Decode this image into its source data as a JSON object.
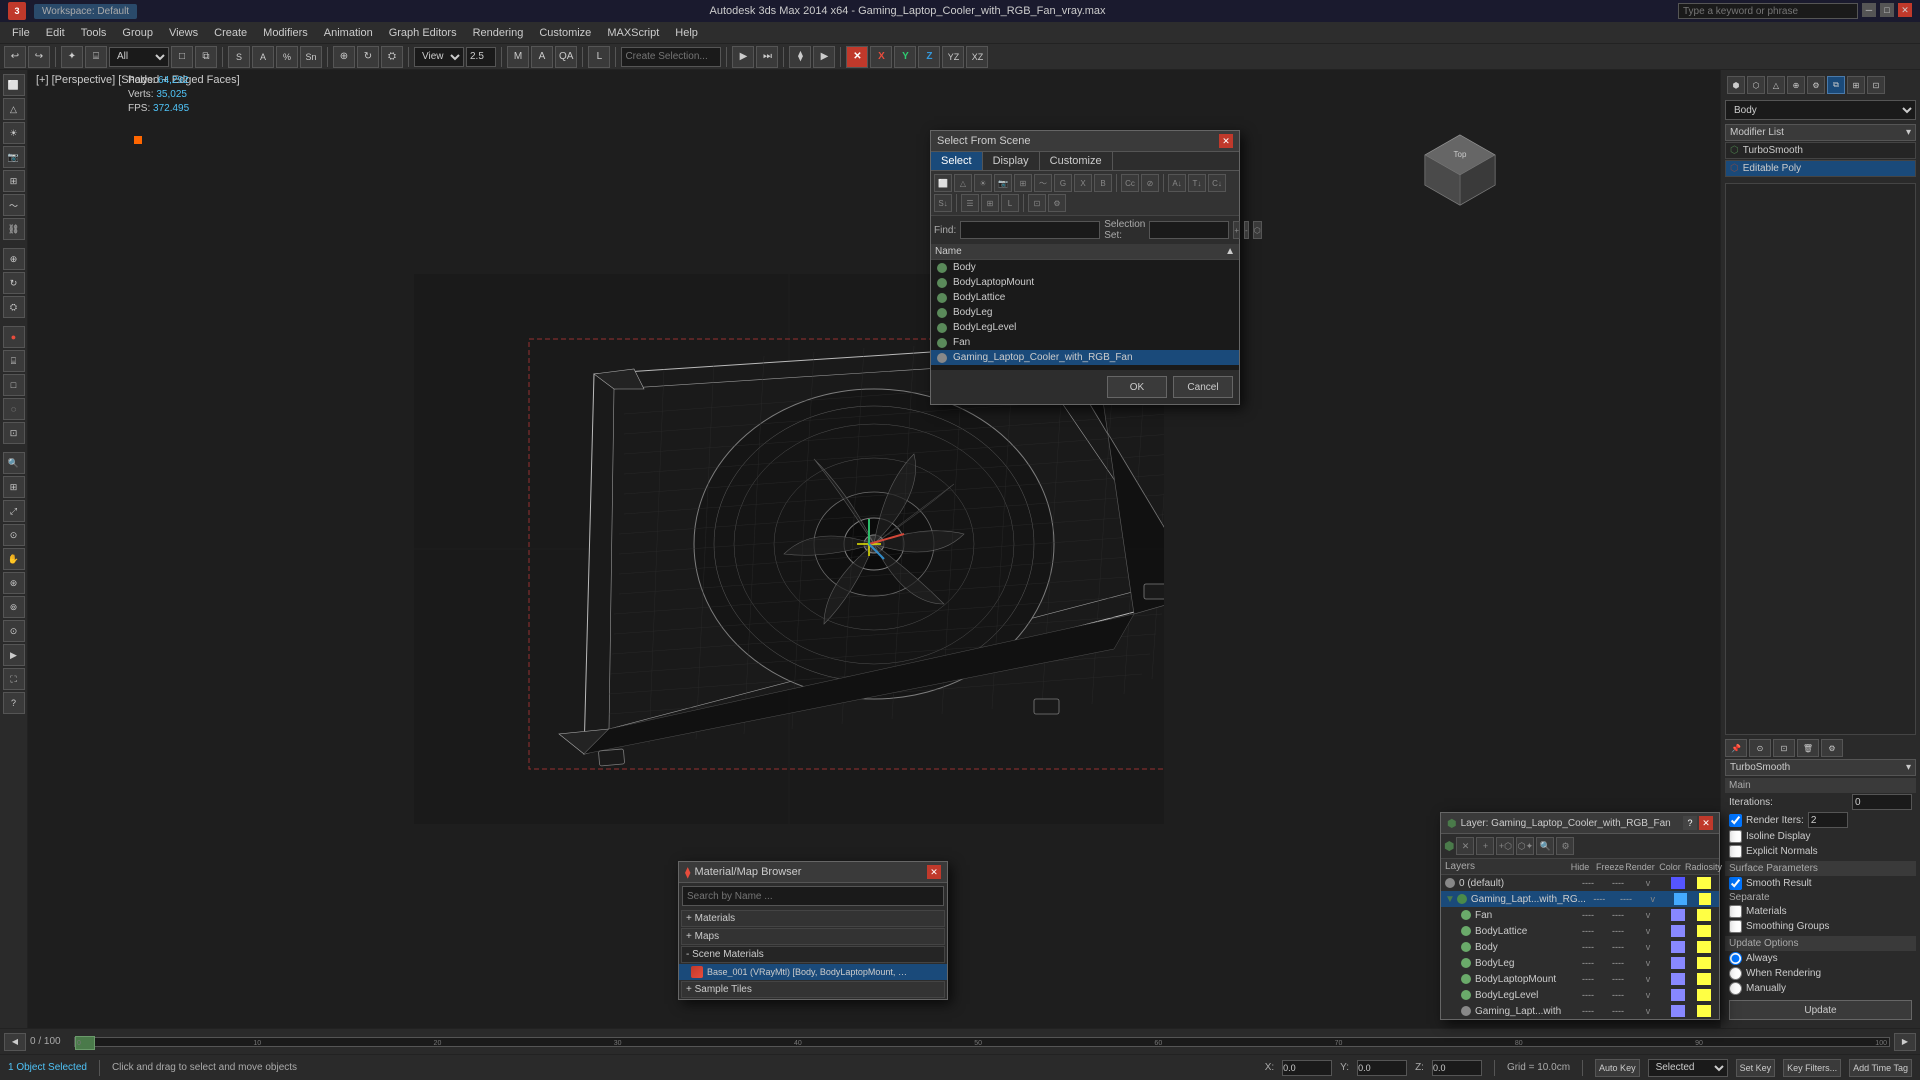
{
  "app": {
    "title": "Autodesk 3ds Max 2014 x64 - Gaming_Laptop_Cooler_with_RGB_Fan_vray.max",
    "workspace": "Workspace: Default"
  },
  "title_bar": {
    "workspace_label": "Workspace: Default",
    "title": "Autodesk 3ds Max 2014 x64 - Gaming_Laptop_Cooler_with_RGB_Fan_vray.max",
    "search_placeholder": "Type a keyword or phrase"
  },
  "menu_bar": {
    "items": [
      "File",
      "Edit",
      "Tools",
      "Group",
      "Views",
      "Create",
      "Modifiers",
      "Animation",
      "Graph Editors",
      "Rendering",
      "Customize",
      "MAXScript",
      "Help"
    ]
  },
  "viewport": {
    "label": "[+] [Perspective] [Shaded + Edged Faces]",
    "stats": {
      "polys_label": "Polys:",
      "polys_value": "64,292",
      "verts_label": "Verts:",
      "verts_value": "35,025",
      "fps_label": "FPS:",
      "fps_value": "372.495"
    }
  },
  "select_from_scene": {
    "title": "Select From Scene",
    "tabs": [
      "Select",
      "Display",
      "Customize"
    ],
    "active_tab": "Select",
    "find_label": "Find:",
    "find_placeholder": "",
    "selset_label": "Selection Set:",
    "name_header": "Name",
    "items": [
      {
        "name": "Body",
        "selected": false
      },
      {
        "name": "BodyLaptopMount",
        "selected": false
      },
      {
        "name": "BodyLattice",
        "selected": false
      },
      {
        "name": "BodyLeg",
        "selected": false
      },
      {
        "name": "BodyLegLevel",
        "selected": false
      },
      {
        "name": "Fan",
        "selected": false
      },
      {
        "name": "Gaming_Laptop_Cooler_with_RGB_Fan",
        "selected": true
      }
    ],
    "ok_button": "OK",
    "cancel_button": "Cancel"
  },
  "material_browser": {
    "title": "Material/Map Browser",
    "close_label": "×",
    "search_placeholder": "Search by Name ...",
    "groups": [
      {
        "label": "+ Materials",
        "open": false
      },
      {
        "label": "+ Maps",
        "open": false
      },
      {
        "label": "- Scene Materials",
        "open": true
      }
    ],
    "scene_materials": [
      {
        "name": "Base_001 (VRayMtl) [Body, BodyLaptopMount, BodyLattice, B..."
      }
    ],
    "sample_tiles_label": "+ Sample Tiles"
  },
  "layer_dialog": {
    "title": "Layer: Gaming_Laptop_Cooler_with_RGB_Fan",
    "close_label": "×",
    "columns": [
      "Layers",
      "Hide",
      "Freeze",
      "Render",
      "Color",
      "Radiosity"
    ],
    "layers": [
      {
        "name": "0 (default)",
        "indent": 0
      },
      {
        "name": "Gaming_Lapt...with_RG...",
        "indent": 0
      },
      {
        "name": "Fan",
        "indent": 1
      },
      {
        "name": "BodyLattice",
        "indent": 1
      },
      {
        "name": "Body",
        "indent": 1
      },
      {
        "name": "BodyLeg",
        "indent": 1
      },
      {
        "name": "BodyLaptopMount",
        "indent": 1
      },
      {
        "name": "BodyLegLevel",
        "indent": 1
      },
      {
        "name": "Gaming_Lapt...with",
        "indent": 1
      }
    ]
  },
  "right_panel": {
    "body_label": "Body",
    "modifier_list_label": "Modifier List",
    "modifiers": [
      {
        "name": "TurboSmooth",
        "selected": false
      },
      {
        "name": "Editable Poly",
        "selected": true
      }
    ],
    "turbosmoothTitle": "TurboSmooth",
    "main_section": "Main",
    "iterations_label": "Iterations:",
    "iterations_value": "0",
    "render_iters_label": "Render Iters:",
    "render_iters_value": "2",
    "isoline_display_label": "Isoline Display",
    "explicit_normals_label": "Explicit Normals",
    "surface_params_label": "Surface Parameters",
    "smooth_result_label": "Smooth Result",
    "separate_label": "Separate",
    "materials_label": "Materials",
    "smoothing_groups_label": "Smoothing Groups",
    "update_options_label": "Update Options",
    "always_label": "Always",
    "when_rendering_label": "When Rendering",
    "manually_label": "Manually",
    "update_button": "Update"
  },
  "status_bar": {
    "objects_selected": "1 Object Selected",
    "hint": "Click and drag to select and move objects",
    "x_label": "X:",
    "y_label": "Y:",
    "z_label": "Z:",
    "grid_label": "Grid = 10.0cm",
    "autokey_label": "Auto Key",
    "selected_label": "Selected",
    "addtime_label": "Add Time Tag"
  },
  "timeline": {
    "start": "0",
    "end": "100",
    "current": "0 / 100"
  },
  "toolbar1": {
    "undo_icon": "↩",
    "redo_icon": "↪",
    "select_icon": "✦",
    "move_icon": "⊕",
    "rotate_icon": "↻",
    "scale_icon": "⛭",
    "select_region_icon": "□",
    "snap_icon": "S",
    "mirror_icon": "M",
    "align_icon": "A",
    "layers_icon": "L",
    "material_editor_icon": "⧫",
    "render_icon": "▶"
  },
  "axis_labels": {
    "x": "X",
    "y": "Y",
    "yz": "YZ",
    "xz": "XZ"
  },
  "nav_cube": {
    "face": "Top"
  }
}
